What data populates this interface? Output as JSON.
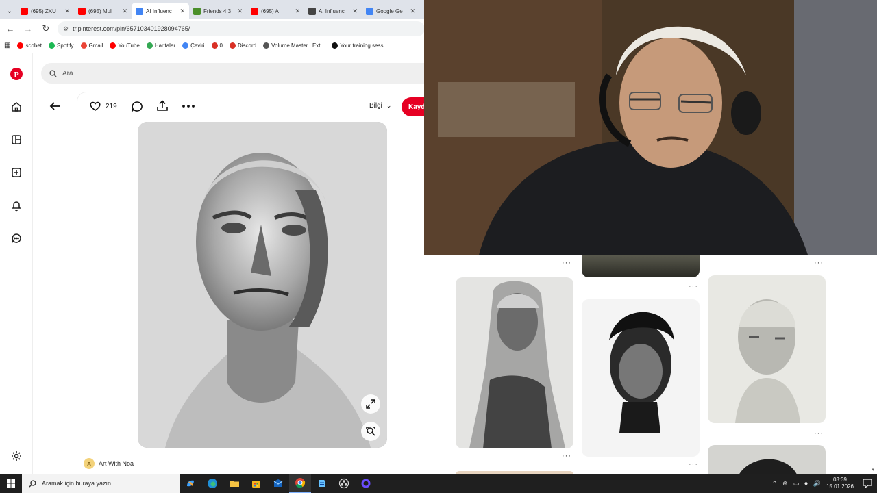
{
  "browser": {
    "tabs": [
      {
        "title": "(695) ZKU",
        "favicon": "youtube-icon",
        "color": "#ff0000"
      },
      {
        "title": "(695) Mul",
        "favicon": "youtube-icon",
        "color": "#ff0000"
      },
      {
        "title": "AI Influenc",
        "favicon": "docs-icon",
        "color": "#4285f4"
      },
      {
        "title": "Friends 4:3",
        "favicon": "tv-icon",
        "color": "#4a8f2a"
      },
      {
        "title": "(695) A",
        "favicon": "youtube-icon",
        "color": "#ff0000"
      },
      {
        "title": "AI Influenc",
        "favicon": "openai-icon",
        "color": "#444444"
      },
      {
        "title": "Google Ge",
        "favicon": "gemini-icon",
        "color": "#4285f4"
      }
    ],
    "url": "tr.pinterest.com/pin/657103401928094765/",
    "bookmarks": [
      {
        "label": "scobet",
        "color": "#ff0000"
      },
      {
        "label": "Spotify",
        "color": "#1db954"
      },
      {
        "label": "Gmail",
        "color": "#ea4335"
      },
      {
        "label": "YouTube",
        "color": "#ff0000"
      },
      {
        "label": "Haritalar",
        "color": "#34a853"
      },
      {
        "label": "Çeviri",
        "color": "#4285f4"
      },
      {
        "label": "0",
        "color": "#d93025"
      },
      {
        "label": "Discord",
        "color": "#d93025"
      },
      {
        "label": "Volume Master | Ext...",
        "color": "#555555"
      },
      {
        "label": "Your training sess",
        "color": "#111111"
      }
    ]
  },
  "search": {
    "placeholder": "Ara"
  },
  "pin": {
    "likes": "219",
    "info_label": "Bilgi",
    "save_label": "Kayd",
    "creator_name": "Art With Noa",
    "creator_initial": "A"
  },
  "brand_color": "#e60023",
  "taskbar": {
    "search_placeholder": "Aramak için buraya yazın",
    "time": "03:39",
    "date": "15.01.2026"
  }
}
